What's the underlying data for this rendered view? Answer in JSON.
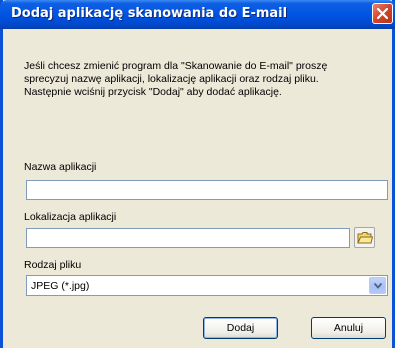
{
  "window": {
    "title": "Dodaj aplikację skanowania do E-mail",
    "close_icon": "close-icon"
  },
  "description": {
    "line1": "Jeśli chcesz zmienić program dla \"Skanowanie do E-mail\"  proszę",
    "line2": "sprecyzuj nazwę aplikacji, lokalizację aplikacji oraz rodzaj pliku.",
    "line3": "Następnie wciśnij przycisk \"Dodaj\" aby dodać aplikację."
  },
  "fields": {
    "app_name_label": "Nazwa aplikacji",
    "app_name_value": "",
    "app_location_label": "Lokalizacja aplikacji",
    "app_location_value": "",
    "browse_icon": "folder-icon",
    "file_type_label": "Rodzaj pliku",
    "file_type_value": "JPEG (*.jpg)"
  },
  "buttons": {
    "add_label": "Dodaj",
    "cancel_label": "Anuluj"
  },
  "colors": {
    "titlebar": "#0054e3",
    "dialog_bg": "#ece9d8",
    "close_button": "#d2452a",
    "field_border": "#7f9db9"
  }
}
